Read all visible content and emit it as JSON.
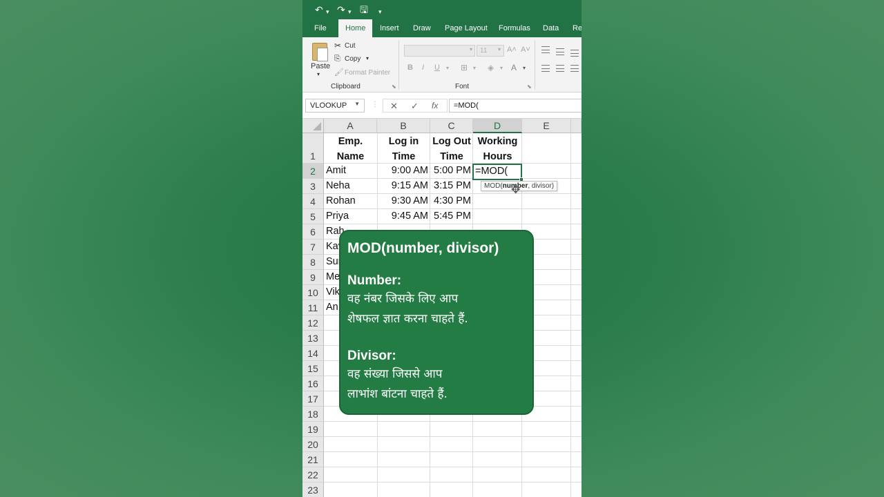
{
  "window": {
    "qat_undo": "↶",
    "qat_redo": "↷",
    "qat_save": "🖫",
    "qat_more": "▾"
  },
  "tabs": [
    "File",
    "Home",
    "Insert",
    "Draw",
    "Page Layout",
    "Formulas",
    "Data",
    "Re"
  ],
  "active_tab": "Home",
  "ribbon": {
    "paste_label": "Paste",
    "cut_label": "Cut",
    "copy_label": "Copy",
    "format_painter_label": "Format Painter",
    "clipboard_group": "Clipboard",
    "font_group": "Font",
    "font_size": "11",
    "bold": "B",
    "italic": "I",
    "underline": "U",
    "grow_font": "A˄",
    "shrink_font": "A˅",
    "font_color": "A"
  },
  "formula_bar": {
    "name_box": "VLOOKUP",
    "cancel": "✕",
    "enter": "✓",
    "fx": "fx",
    "formula": "=MOD("
  },
  "columns": [
    "A",
    "B",
    "C",
    "D",
    "E"
  ],
  "selected_column": "D",
  "rows": [
    "1",
    "2",
    "3",
    "4",
    "5",
    "6",
    "7",
    "8",
    "9",
    "10",
    "11",
    "12",
    "13",
    "14",
    "15",
    "16",
    "17",
    "18",
    "19",
    "20",
    "21",
    "22",
    "23"
  ],
  "header_row": {
    "a": [
      "Emp.",
      "Name"
    ],
    "b": [
      "Log in",
      "Time"
    ],
    "c": [
      "Log Out",
      "Time"
    ],
    "d": [
      "Working",
      "Hours"
    ]
  },
  "data_rows": [
    {
      "name": "Amit",
      "login": "9:00 AM",
      "logout": "5:00 PM"
    },
    {
      "name": "Neha",
      "login": "9:15 AM",
      "logout": "3:15 PM"
    },
    {
      "name": "Rohan",
      "login": "9:30 AM",
      "logout": "4:30 PM"
    },
    {
      "name": "Priya",
      "login": "9:45 AM",
      "logout": "5:45 PM"
    },
    {
      "name": "Rah"
    },
    {
      "name": "Kav"
    },
    {
      "name": "Sur"
    },
    {
      "name": "Me"
    },
    {
      "name": "Vik"
    },
    {
      "name": "An"
    }
  ],
  "active_cell_value": "=MOD(",
  "tooltip": {
    "fn": "MOD(",
    "arg_bold": "number",
    "rest": ", divisor)"
  },
  "card": {
    "syntax": "MOD(number, divisor)",
    "number_label": "Number:",
    "number_desc": "वह नंबर जिसके लिए आप\nशेषफल ज्ञात करना चाहते हैं.",
    "divisor_label": "Divisor:",
    "divisor_desc": "वह संख्या जिससे आप\nलाभांश बांटना चाहते हैं."
  },
  "colors": {
    "excel_green": "#217346",
    "card_green": "#237c44"
  }
}
